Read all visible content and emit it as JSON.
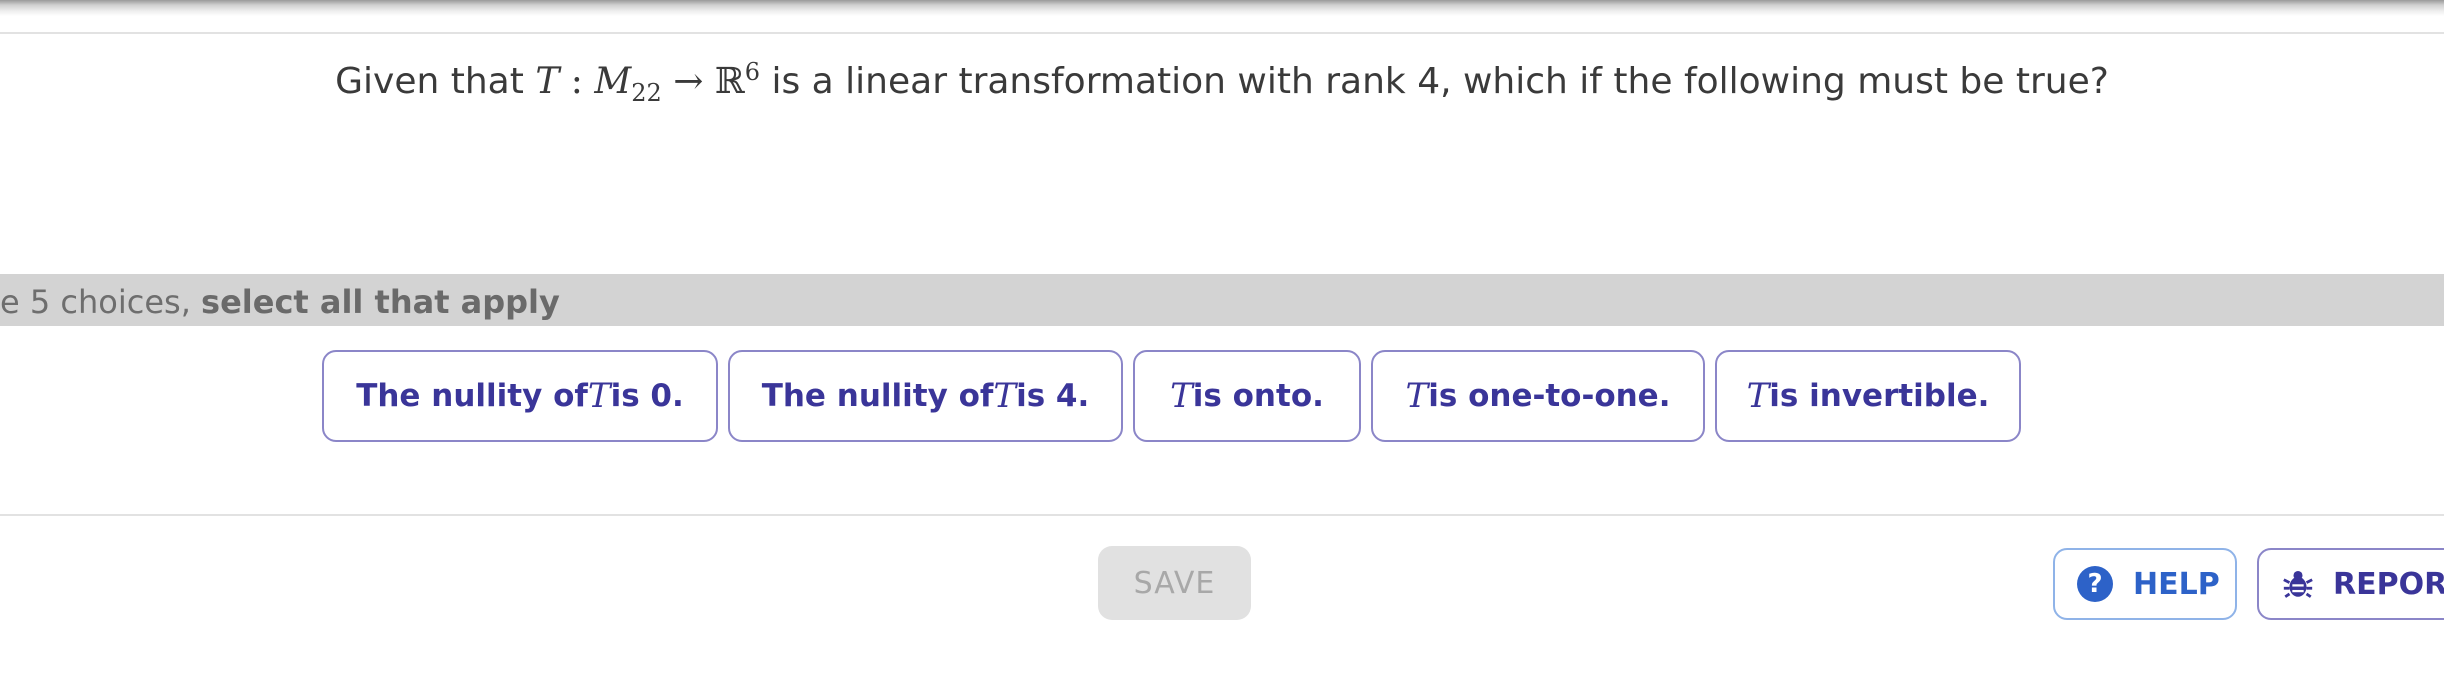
{
  "question": {
    "prefix": "Given that ",
    "symbol_T": "T",
    "colon": " : ",
    "domain_base": "M",
    "domain_sub": "22",
    "arrow": " → ",
    "codomain": "ℝ",
    "codomain_sup": "6",
    "suffix": " is a linear transformation with rank 4, which if the following must be true?"
  },
  "instruction": {
    "lead": "e 5 choices, ",
    "emphasis": "select all that apply"
  },
  "choices": [
    {
      "before": "The nullity of ",
      "symbol": "T",
      "after": " is 0."
    },
    {
      "before": "The nullity of ",
      "symbol": "T",
      "after": " is 4."
    },
    {
      "before": "",
      "symbol": "T",
      "after": " is onto."
    },
    {
      "before": "",
      "symbol": "T",
      "after": " is one-to-one."
    },
    {
      "before": "",
      "symbol": "T",
      "after": " is invertible."
    }
  ],
  "footer": {
    "save_label": "SAVE",
    "help_label": "HELP",
    "help_icon": "?",
    "report_label": "REPOR"
  },
  "colors": {
    "choice_text": "#3a3599",
    "choice_border": "#8b86c8",
    "help_blue": "#2d62c8",
    "instruction_bg": "#d3d3d3"
  },
  "icons": {
    "help": "question-circle-icon",
    "report": "bug-icon"
  }
}
